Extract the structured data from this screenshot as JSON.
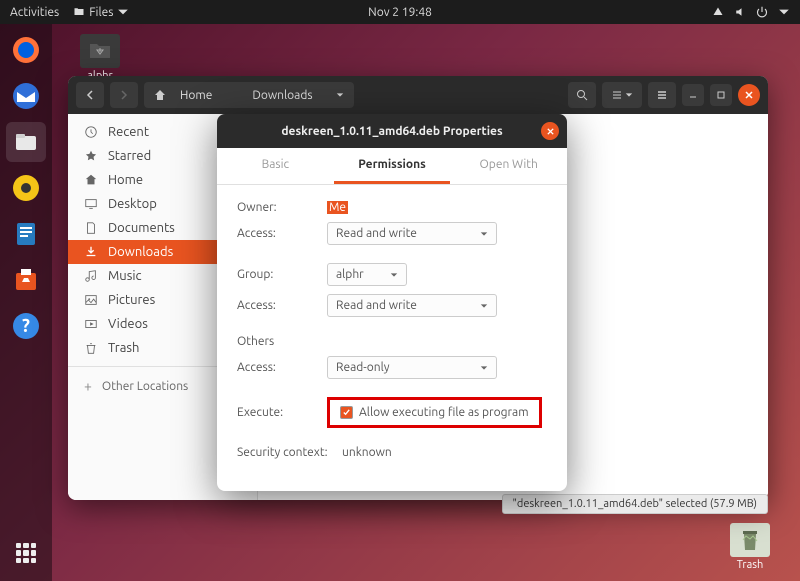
{
  "topbar": {
    "activities": "Activities",
    "files": "Files",
    "datetime": "Nov 2  19:48"
  },
  "desktop": {
    "alphr": "alphr",
    "trash": "Trash"
  },
  "files": {
    "path_home": "Home",
    "path_current": "Downloads",
    "sidebar": {
      "recent": "Recent",
      "starred": "Starred",
      "home": "Home",
      "desktop": "Desktop",
      "documents": "Documents",
      "downloads": "Downloads",
      "music": "Music",
      "pictures": "Pictures",
      "videos": "Videos",
      "trash": "Trash",
      "other": "Other Locations"
    }
  },
  "statusbar": "\"deskreen_1.0.11_amd64.deb\" selected  (57.9 MB)",
  "props": {
    "title": "deskreen_1.0.11_amd64.deb Properties",
    "tabs": {
      "basic": "Basic",
      "permissions": "Permissions",
      "openwith": "Open With"
    },
    "owner_label": "Owner:",
    "owner_value": "Me",
    "access_label": "Access:",
    "access_rw": "Read and write",
    "group_label": "Group:",
    "group_value": "alphr",
    "others_label": "Others",
    "access_ro": "Read-only",
    "execute_label": "Execute:",
    "execute_check": "Allow executing file as program",
    "security_label": "Security context:",
    "security_value": "unknown"
  }
}
